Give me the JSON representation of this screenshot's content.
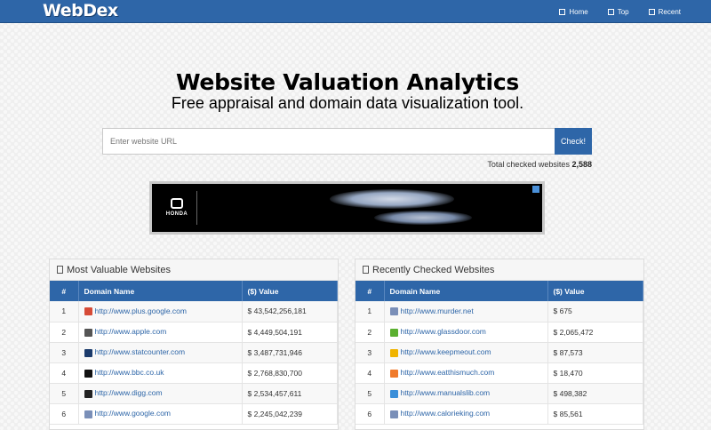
{
  "nav": {
    "brand": "WebDex",
    "links": [
      {
        "label": "Home",
        "icon": "home-icon"
      },
      {
        "label": "Top",
        "icon": "list-icon"
      },
      {
        "label": "Recent",
        "icon": "clock-icon"
      }
    ]
  },
  "hero": {
    "title": "Website Valuation Analytics",
    "subtitle": "Free appraisal and domain data visualization tool."
  },
  "search": {
    "placeholder": "Enter website URL",
    "button_label": "Check!",
    "total_label": "Total checked websites",
    "total_value": "2,588"
  },
  "ad": {
    "logo_text": "HONDA"
  },
  "panels": {
    "most_valuable": {
      "title": "Most Valuable Websites",
      "columns": [
        "#",
        "Domain Name",
        "($) Value"
      ],
      "rows": [
        {
          "rank": "1",
          "domain": "http://www.plus.google.com",
          "value": "$ 43,542,256,181",
          "favicon_color": "#d64b37"
        },
        {
          "rank": "2",
          "domain": "http://www.apple.com",
          "value": "$ 4,449,504,191",
          "favicon_color": "#555555"
        },
        {
          "rank": "3",
          "domain": "http://www.statcounter.com",
          "value": "$ 3,487,731,946",
          "favicon_color": "#1b3a6b"
        },
        {
          "rank": "4",
          "domain": "http://www.bbc.co.uk",
          "value": "$ 2,768,830,700",
          "favicon_color": "#111111"
        },
        {
          "rank": "5",
          "domain": "http://www.digg.com",
          "value": "$ 2,534,457,611",
          "favicon_color": "#222222"
        },
        {
          "rank": "6",
          "domain": "http://www.google.com",
          "value": "$ 2,245,042,239",
          "favicon_color": "#7a8fb8"
        }
      ]
    },
    "recently_checked": {
      "title": "Recently Checked Websites",
      "columns": [
        "#",
        "Domain Name",
        "($) Value"
      ],
      "rows": [
        {
          "rank": "1",
          "domain": "http://www.murder.net",
          "value": "$ 675",
          "favicon_color": "#7a8fb8"
        },
        {
          "rank": "2",
          "domain": "http://www.glassdoor.com",
          "value": "$ 2,065,472",
          "favicon_color": "#5bb030"
        },
        {
          "rank": "3",
          "domain": "http://www.keepmeout.com",
          "value": "$ 87,573",
          "favicon_color": "#f0b400"
        },
        {
          "rank": "4",
          "domain": "http://www.eatthismuch.com",
          "value": "$ 18,470",
          "favicon_color": "#f07a2a"
        },
        {
          "rank": "5",
          "domain": "http://www.manualslib.com",
          "value": "$ 498,382",
          "favicon_color": "#3a8fd9"
        },
        {
          "rank": "6",
          "domain": "http://www.calorieking.com",
          "value": "$ 85,561",
          "favicon_color": "#7a8fb8"
        }
      ]
    }
  }
}
